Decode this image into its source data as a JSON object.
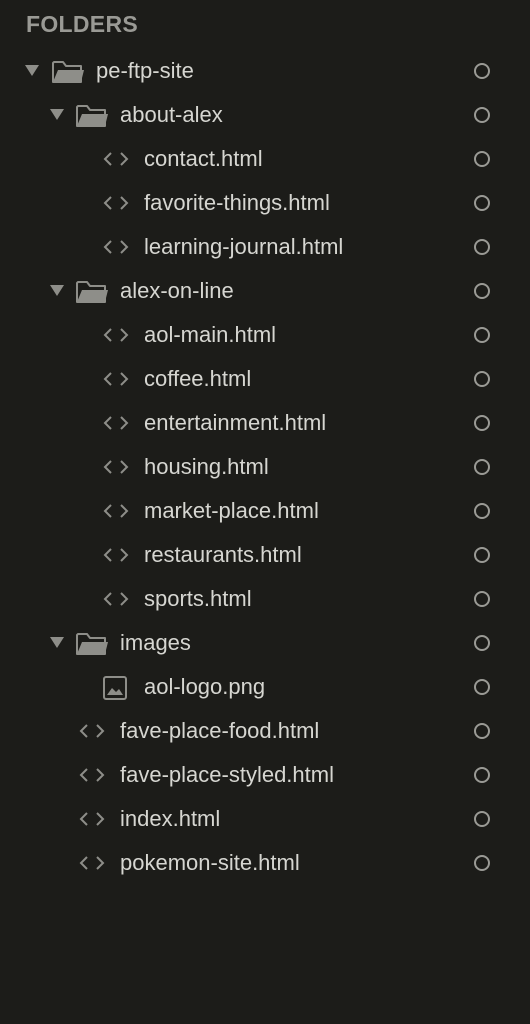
{
  "sidebar": {
    "header": "FOLDERS",
    "items": [
      {
        "label": "pe-ftp-site",
        "type": "folder"
      },
      {
        "label": "about-alex",
        "type": "folder"
      },
      {
        "label": "contact.html",
        "type": "code-file"
      },
      {
        "label": "favorite-things.html",
        "type": "code-file"
      },
      {
        "label": "learning-journal.html",
        "type": "code-file"
      },
      {
        "label": "alex-on-line",
        "type": "folder"
      },
      {
        "label": "aol-main.html",
        "type": "code-file"
      },
      {
        "label": "coffee.html",
        "type": "code-file"
      },
      {
        "label": "entertainment.html",
        "type": "code-file"
      },
      {
        "label": "housing.html",
        "type": "code-file"
      },
      {
        "label": "market-place.html",
        "type": "code-file"
      },
      {
        "label": "restaurants.html",
        "type": "code-file"
      },
      {
        "label": "sports.html",
        "type": "code-file"
      },
      {
        "label": "images",
        "type": "folder"
      },
      {
        "label": "aol-logo.png",
        "type": "image-file"
      },
      {
        "label": "fave-place-food.html",
        "type": "code-file"
      },
      {
        "label": "fave-place-styled.html",
        "type": "code-file"
      },
      {
        "label": "index.html",
        "type": "code-file"
      },
      {
        "label": "pokemon-site.html",
        "type": "code-file"
      }
    ]
  },
  "colors": {
    "background": "#1c1c19",
    "text": "#d6d6d1",
    "header": "#9a9a95",
    "icon": "#8e8e89"
  },
  "icons": {
    "folder": "folder-open-icon",
    "code_file": "code-file-icon",
    "image_file": "image-file-icon",
    "status": "status-circle-icon",
    "expand": "disclosure-triangle-icon"
  }
}
